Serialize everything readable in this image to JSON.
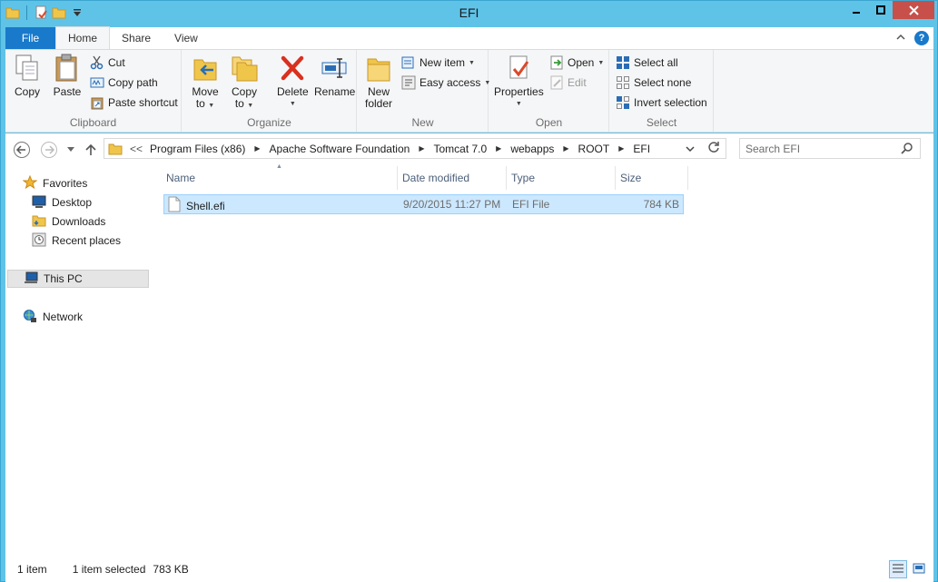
{
  "window": {
    "title": "EFI"
  },
  "title_buttons": {
    "minimize": "▬",
    "maximize": "□",
    "close": "✕"
  },
  "ribbon_tabs": {
    "file": "File",
    "home": "Home",
    "share": "Share",
    "view": "View"
  },
  "clipboard": {
    "label": "Clipboard",
    "copy": "Copy",
    "paste": "Paste",
    "cut": "Cut",
    "copy_path": "Copy path",
    "paste_shortcut": "Paste shortcut"
  },
  "organize": {
    "label": "Organize",
    "move_to_1": "Move",
    "move_to_2": "to",
    "copy_to_1": "Copy",
    "copy_to_2": "to",
    "delete": "Delete",
    "rename": "Rename"
  },
  "new_group": {
    "label": "New",
    "new_folder_1": "New",
    "new_folder_2": "folder",
    "new_item": "New item",
    "easy_access": "Easy access"
  },
  "open_group": {
    "label": "Open",
    "properties": "Properties",
    "open": "Open",
    "edit": "Edit"
  },
  "select_group": {
    "label": "Select",
    "select_all": "Select all",
    "select_none": "Select none",
    "invert_selection": "Invert selection"
  },
  "address": {
    "overflow": "<<",
    "crumbs": [
      "Program Files (x86)",
      "Apache Software Foundation",
      "Tomcat 7.0",
      "webapps",
      "ROOT",
      "EFI"
    ]
  },
  "search": {
    "placeholder": "Search EFI"
  },
  "nav": {
    "favorites": "Favorites",
    "desktop": "Desktop",
    "downloads": "Downloads",
    "recent_places": "Recent places",
    "this_pc": "This PC",
    "network": "Network"
  },
  "columns": {
    "name": "Name",
    "date_modified": "Date modified",
    "type": "Type",
    "size": "Size"
  },
  "files": [
    {
      "name": "Shell.efi",
      "date_modified": "9/20/2015 11:27 PM",
      "type": "EFI File",
      "size": "784 KB"
    }
  ],
  "status": {
    "item_count": "1 item",
    "selected": "1 item selected",
    "selected_size": "783 KB"
  },
  "colors": {
    "titlebar": "#5fc3e8",
    "file_tab": "#1979ca",
    "selection": "#cce8ff",
    "close_button": "#c7504a"
  }
}
